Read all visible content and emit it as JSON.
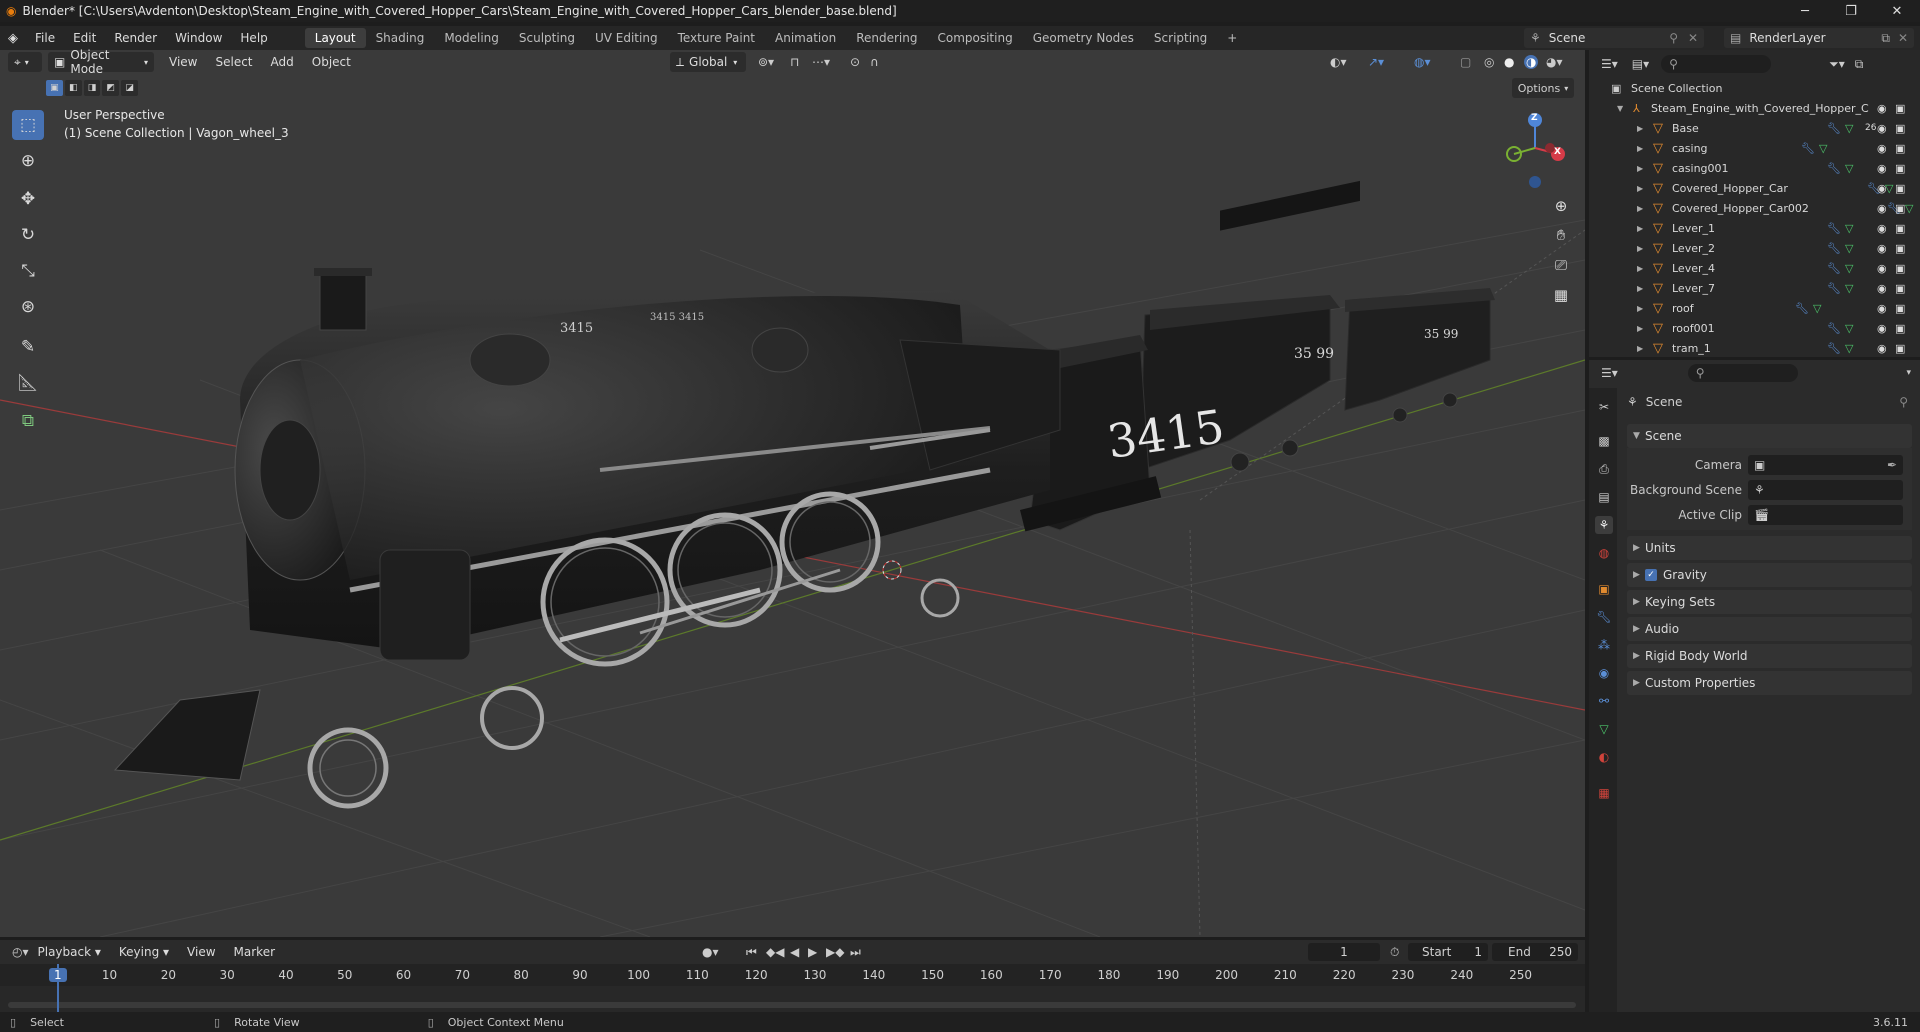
{
  "window": {
    "title": "Blender* [C:\\Users\\Avdenton\\Desktop\\Steam_Engine_with_Covered_Hopper_Cars\\Steam_Engine_with_Covered_Hopper_Cars_blender_base.blend]",
    "minimize": "─",
    "maximize": "❐",
    "close": "✕"
  },
  "menus": [
    "File",
    "Edit",
    "Render",
    "Window",
    "Help"
  ],
  "workspaces": [
    "Layout",
    "Shading",
    "Modeling",
    "Sculpting",
    "UV Editing",
    "Texture Paint",
    "Animation",
    "Rendering",
    "Compositing",
    "Geometry Nodes",
    "Scripting"
  ],
  "add_workspace": "+",
  "scene_name": "Scene",
  "view_layer": "RenderLayer",
  "viewport": {
    "mode": "Object Mode",
    "menus": [
      "View",
      "Select",
      "Add",
      "Object"
    ],
    "transform_orientation": "Global",
    "options_label": "Options",
    "view_label": "User Perspective",
    "context_label": "(1) Scene Collection | Vagon_wheel_3",
    "gizmo": {
      "z": "Z",
      "x": "X"
    },
    "tender_number": "3415",
    "hopper_numbers": [
      "35 99",
      "35 99"
    ],
    "engine_numbers": [
      "3415",
      "3415 3415"
    ]
  },
  "outliner": {
    "root": "Scene Collection",
    "collection": "Steam_Engine_with_Covered_Hopper_C",
    "items": [
      {
        "name": "Base",
        "badge": "26"
      },
      {
        "name": "casing"
      },
      {
        "name": "casing001"
      },
      {
        "name": "Covered_Hopper_Car"
      },
      {
        "name": "Covered_Hopper_Car002"
      },
      {
        "name": "Lever_1"
      },
      {
        "name": "Lever_2"
      },
      {
        "name": "Lever_4"
      },
      {
        "name": "Lever_7"
      },
      {
        "name": "roof"
      },
      {
        "name": "roof001"
      },
      {
        "name": "tram_1"
      }
    ]
  },
  "properties": {
    "title": "Scene",
    "scene_panel": "Scene",
    "camera_label": "Camera",
    "background_scene_label": "Background Scene",
    "active_clip_label": "Active Clip",
    "panels": [
      "Units",
      "Gravity",
      "Keying Sets",
      "Audio",
      "Rigid Body World",
      "Custom Properties"
    ]
  },
  "timeline": {
    "menus": [
      "Playback",
      "Keying",
      "View",
      "Marker"
    ],
    "current_frame": "1",
    "start_label": "Start",
    "start": "1",
    "end_label": "End",
    "end": "250",
    "ticks": [
      "1",
      "10",
      "20",
      "30",
      "40",
      "50",
      "60",
      "70",
      "80",
      "90",
      "100",
      "110",
      "120",
      "130",
      "140",
      "150",
      "160",
      "170",
      "180",
      "190",
      "200",
      "210",
      "220",
      "230",
      "240",
      "250"
    ]
  },
  "status": {
    "select": "Select",
    "rotate": "Rotate View",
    "context_menu": "Object Context Menu",
    "version": "3.6.11"
  }
}
